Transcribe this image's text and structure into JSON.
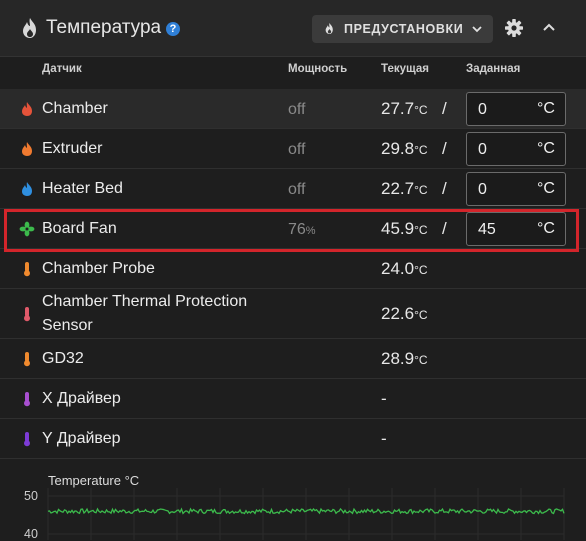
{
  "header": {
    "title": "Температура",
    "help": "?",
    "presets_label": "ПРЕДУСТАНОВКИ"
  },
  "columns": {
    "sensor": "Датчик",
    "power": "Мощность",
    "current": "Текущая",
    "target": "Заданная"
  },
  "rows": [
    {
      "name": "Chamber",
      "power": "off",
      "current": "27.7",
      "current_unit": "°C",
      "slash": "/",
      "target": "0",
      "target_unit": "°C",
      "icon": "flame-icon",
      "icon_color": "#e5533a"
    },
    {
      "name": "Extruder",
      "power": "off",
      "current": "29.8",
      "current_unit": "°C",
      "slash": "/",
      "target": "0",
      "target_unit": "°C",
      "icon": "flame-icon",
      "icon_color": "#f07a30"
    },
    {
      "name": "Heater Bed",
      "power": "off",
      "current": "22.7",
      "current_unit": "°C",
      "slash": "/",
      "target": "0",
      "target_unit": "°C",
      "icon": "flame-icon",
      "icon_color": "#2f8fe0"
    },
    {
      "name": "Board Fan",
      "power": "76",
      "power_unit": "%",
      "current": "45.9",
      "current_unit": "°C",
      "slash": "/",
      "target": "45",
      "target_unit": "°C",
      "icon": "fan-icon",
      "icon_color": "#3cba4c"
    },
    {
      "name": "Chamber Probe",
      "current": "24.0",
      "current_unit": "°C",
      "icon": "thermometer-icon",
      "icon_color": "#f08a2e"
    },
    {
      "name_line1": "Chamber Thermal Protection",
      "name_line2": "Sensor",
      "current": "22.6",
      "current_unit": "°C",
      "icon": "thermometer-icon",
      "icon_color": "#e05a6a"
    },
    {
      "name": "GD32",
      "current": "28.9",
      "current_unit": "°C",
      "icon": "thermometer-icon",
      "icon_color": "#f08a2e"
    },
    {
      "name": "X Драйвер",
      "current": "-",
      "icon": "thermometer-icon",
      "icon_color": "#a84fd0"
    },
    {
      "name": "Y Драйвер",
      "current": "-",
      "icon": "thermometer-icon",
      "icon_color": "#7d3bd6"
    }
  ],
  "chart_data": {
    "type": "line",
    "title": "Temperature °C",
    "y_ticks": [
      "50",
      "40"
    ],
    "series": [
      {
        "name": "Board Fan",
        "color": "#3cba4c",
        "approx_value": 46
      }
    ]
  },
  "colors": {
    "highlight": "#d3252b",
    "help": "#2f7fd6"
  }
}
